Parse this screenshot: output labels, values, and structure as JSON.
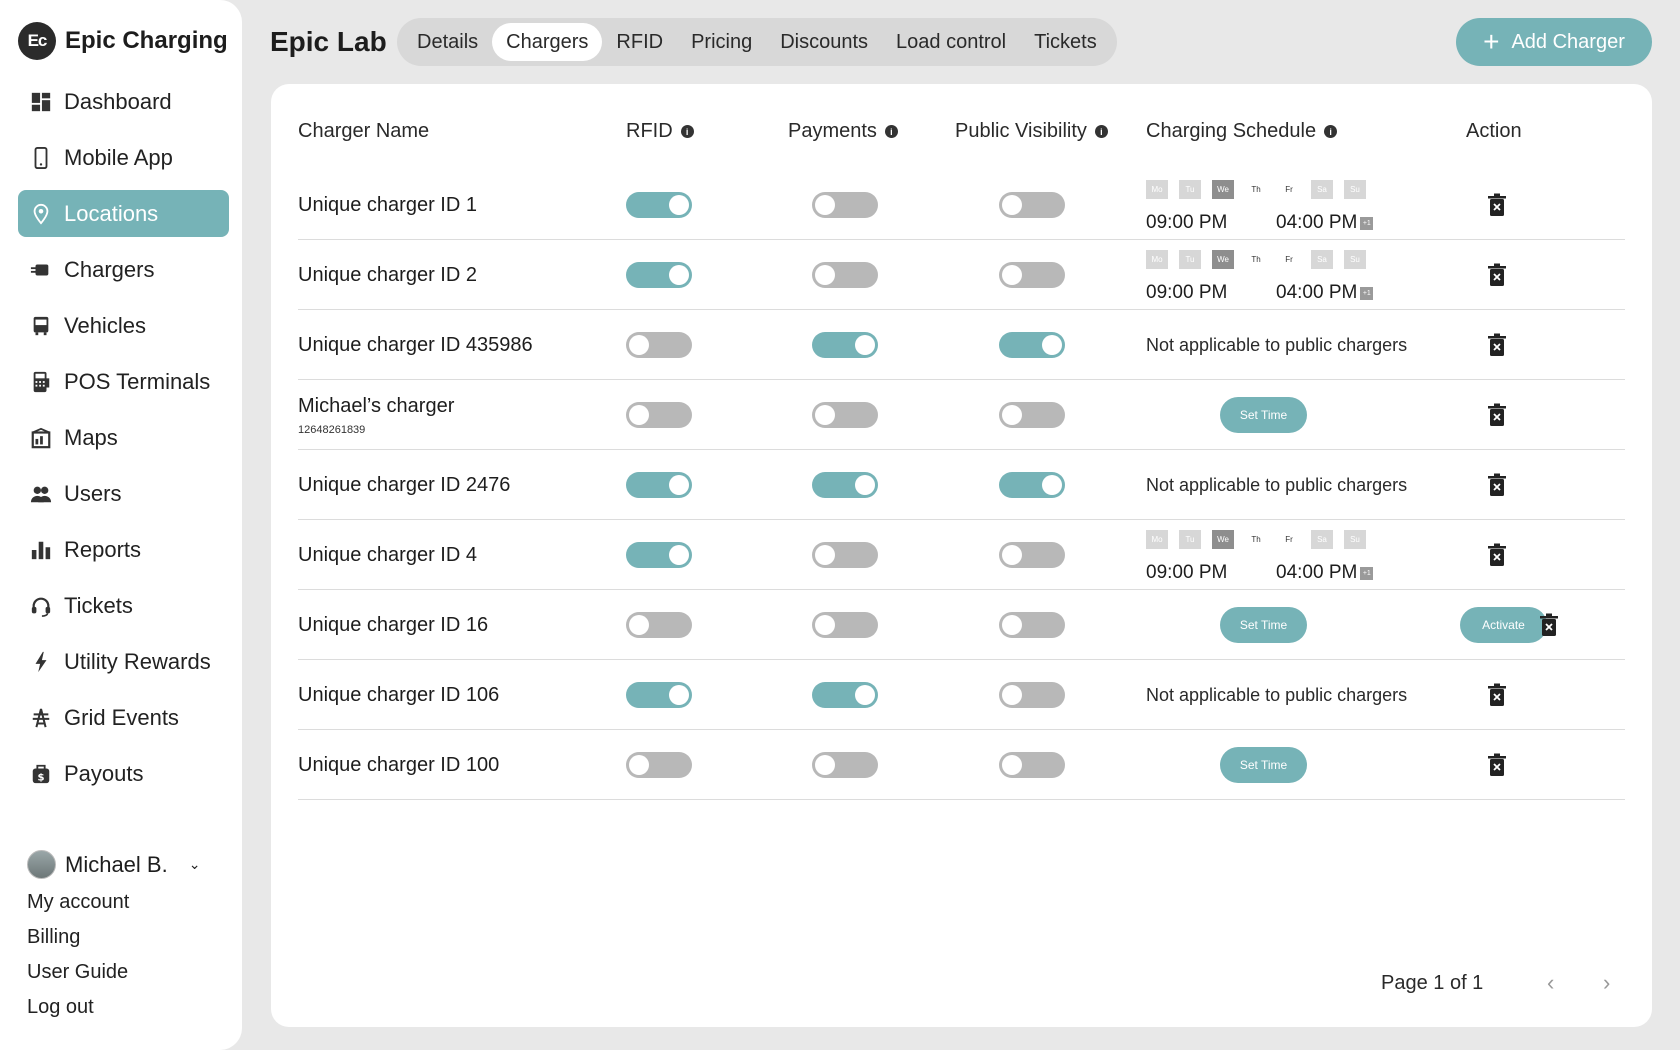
{
  "brand": {
    "logo": "Ec",
    "name": "Epic Charging"
  },
  "nav": [
    {
      "label": "Dashboard",
      "icon": "dashboard-icon"
    },
    {
      "label": "Mobile App",
      "icon": "mobile-icon"
    },
    {
      "label": "Locations",
      "icon": "location-pin-icon",
      "active": true
    },
    {
      "label": "Chargers",
      "icon": "charger-plug-icon"
    },
    {
      "label": "Vehicles",
      "icon": "bus-icon"
    },
    {
      "label": "POS Terminals",
      "icon": "pos-terminal-icon"
    },
    {
      "label": "Maps",
      "icon": "map-icon"
    },
    {
      "label": "Users",
      "icon": "users-icon"
    },
    {
      "label": "Reports",
      "icon": "bar-chart-icon"
    },
    {
      "label": "Tickets",
      "icon": "headset-icon"
    },
    {
      "label": "Utility Rewards",
      "icon": "lightning-icon"
    },
    {
      "label": "Grid Events",
      "icon": "grid-tower-icon"
    },
    {
      "label": "Payouts",
      "icon": "money-bag-icon"
    }
  ],
  "user": {
    "name": "Michael B.",
    "links": [
      "My account",
      "Billing",
      "User Guide",
      "Log out"
    ]
  },
  "header": {
    "title": "Epic Lab",
    "tabs": [
      {
        "label": "Details"
      },
      {
        "label": "Chargers",
        "active": true
      },
      {
        "label": "RFID"
      },
      {
        "label": "Pricing"
      },
      {
        "label": "Discounts"
      },
      {
        "label": "Load control"
      },
      {
        "label": "Tickets"
      }
    ],
    "add_button": "Add Charger"
  },
  "table": {
    "columns": {
      "name": "Charger Name",
      "rfid": "RFID",
      "payments": "Payments",
      "visibility": "Public Visibility",
      "schedule": "Charging Schedule",
      "action": "Action"
    },
    "info_glyph": "i",
    "day_labels": [
      "Mo",
      "Tu",
      "We",
      "Th",
      "Fr",
      "Sa",
      "Su"
    ],
    "plus_one": "+1",
    "set_time_label": "Set Time",
    "activate_label": "Activate",
    "not_applicable": "Not applicable to public chargers",
    "rows": [
      {
        "name": "Unique charger ID 1",
        "rfid": true,
        "payments": false,
        "visibility": false,
        "schedule": {
          "type": "days",
          "start": "09:00 PM",
          "end": "04:00 PM"
        }
      },
      {
        "name": "Unique charger ID 2",
        "rfid": true,
        "payments": false,
        "visibility": false,
        "schedule": {
          "type": "days",
          "start": "09:00 PM",
          "end": "04:00 PM"
        }
      },
      {
        "name": "Unique charger ID 435986",
        "rfid": false,
        "payments": true,
        "visibility": true,
        "schedule": {
          "type": "na"
        }
      },
      {
        "name": "Michael’s charger",
        "sub": "12648261839",
        "rfid": false,
        "payments": false,
        "visibility": false,
        "schedule": {
          "type": "set"
        }
      },
      {
        "name": "Unique charger ID 2476",
        "rfid": true,
        "payments": true,
        "visibility": true,
        "schedule": {
          "type": "na"
        }
      },
      {
        "name": "Unique charger ID 4",
        "rfid": true,
        "payments": false,
        "visibility": false,
        "schedule": {
          "type": "days",
          "start": "09:00 PM",
          "end": "04:00 PM"
        }
      },
      {
        "name": "Unique charger ID 16",
        "rfid": false,
        "payments": false,
        "visibility": false,
        "schedule": {
          "type": "set"
        },
        "activate": true
      },
      {
        "name": "Unique charger ID 106",
        "rfid": true,
        "payments": true,
        "visibility": false,
        "schedule": {
          "type": "na"
        }
      },
      {
        "name": "Unique charger ID 100",
        "rfid": false,
        "payments": false,
        "visibility": false,
        "schedule": {
          "type": "set"
        }
      }
    ]
  },
  "pagination": {
    "text": "Page 1 of 1",
    "prev": "‹",
    "next": "›"
  },
  "colors": {
    "accent": "#76b3b7",
    "toggle_off": "#b8b8b8",
    "background": "#e8e8e8"
  }
}
